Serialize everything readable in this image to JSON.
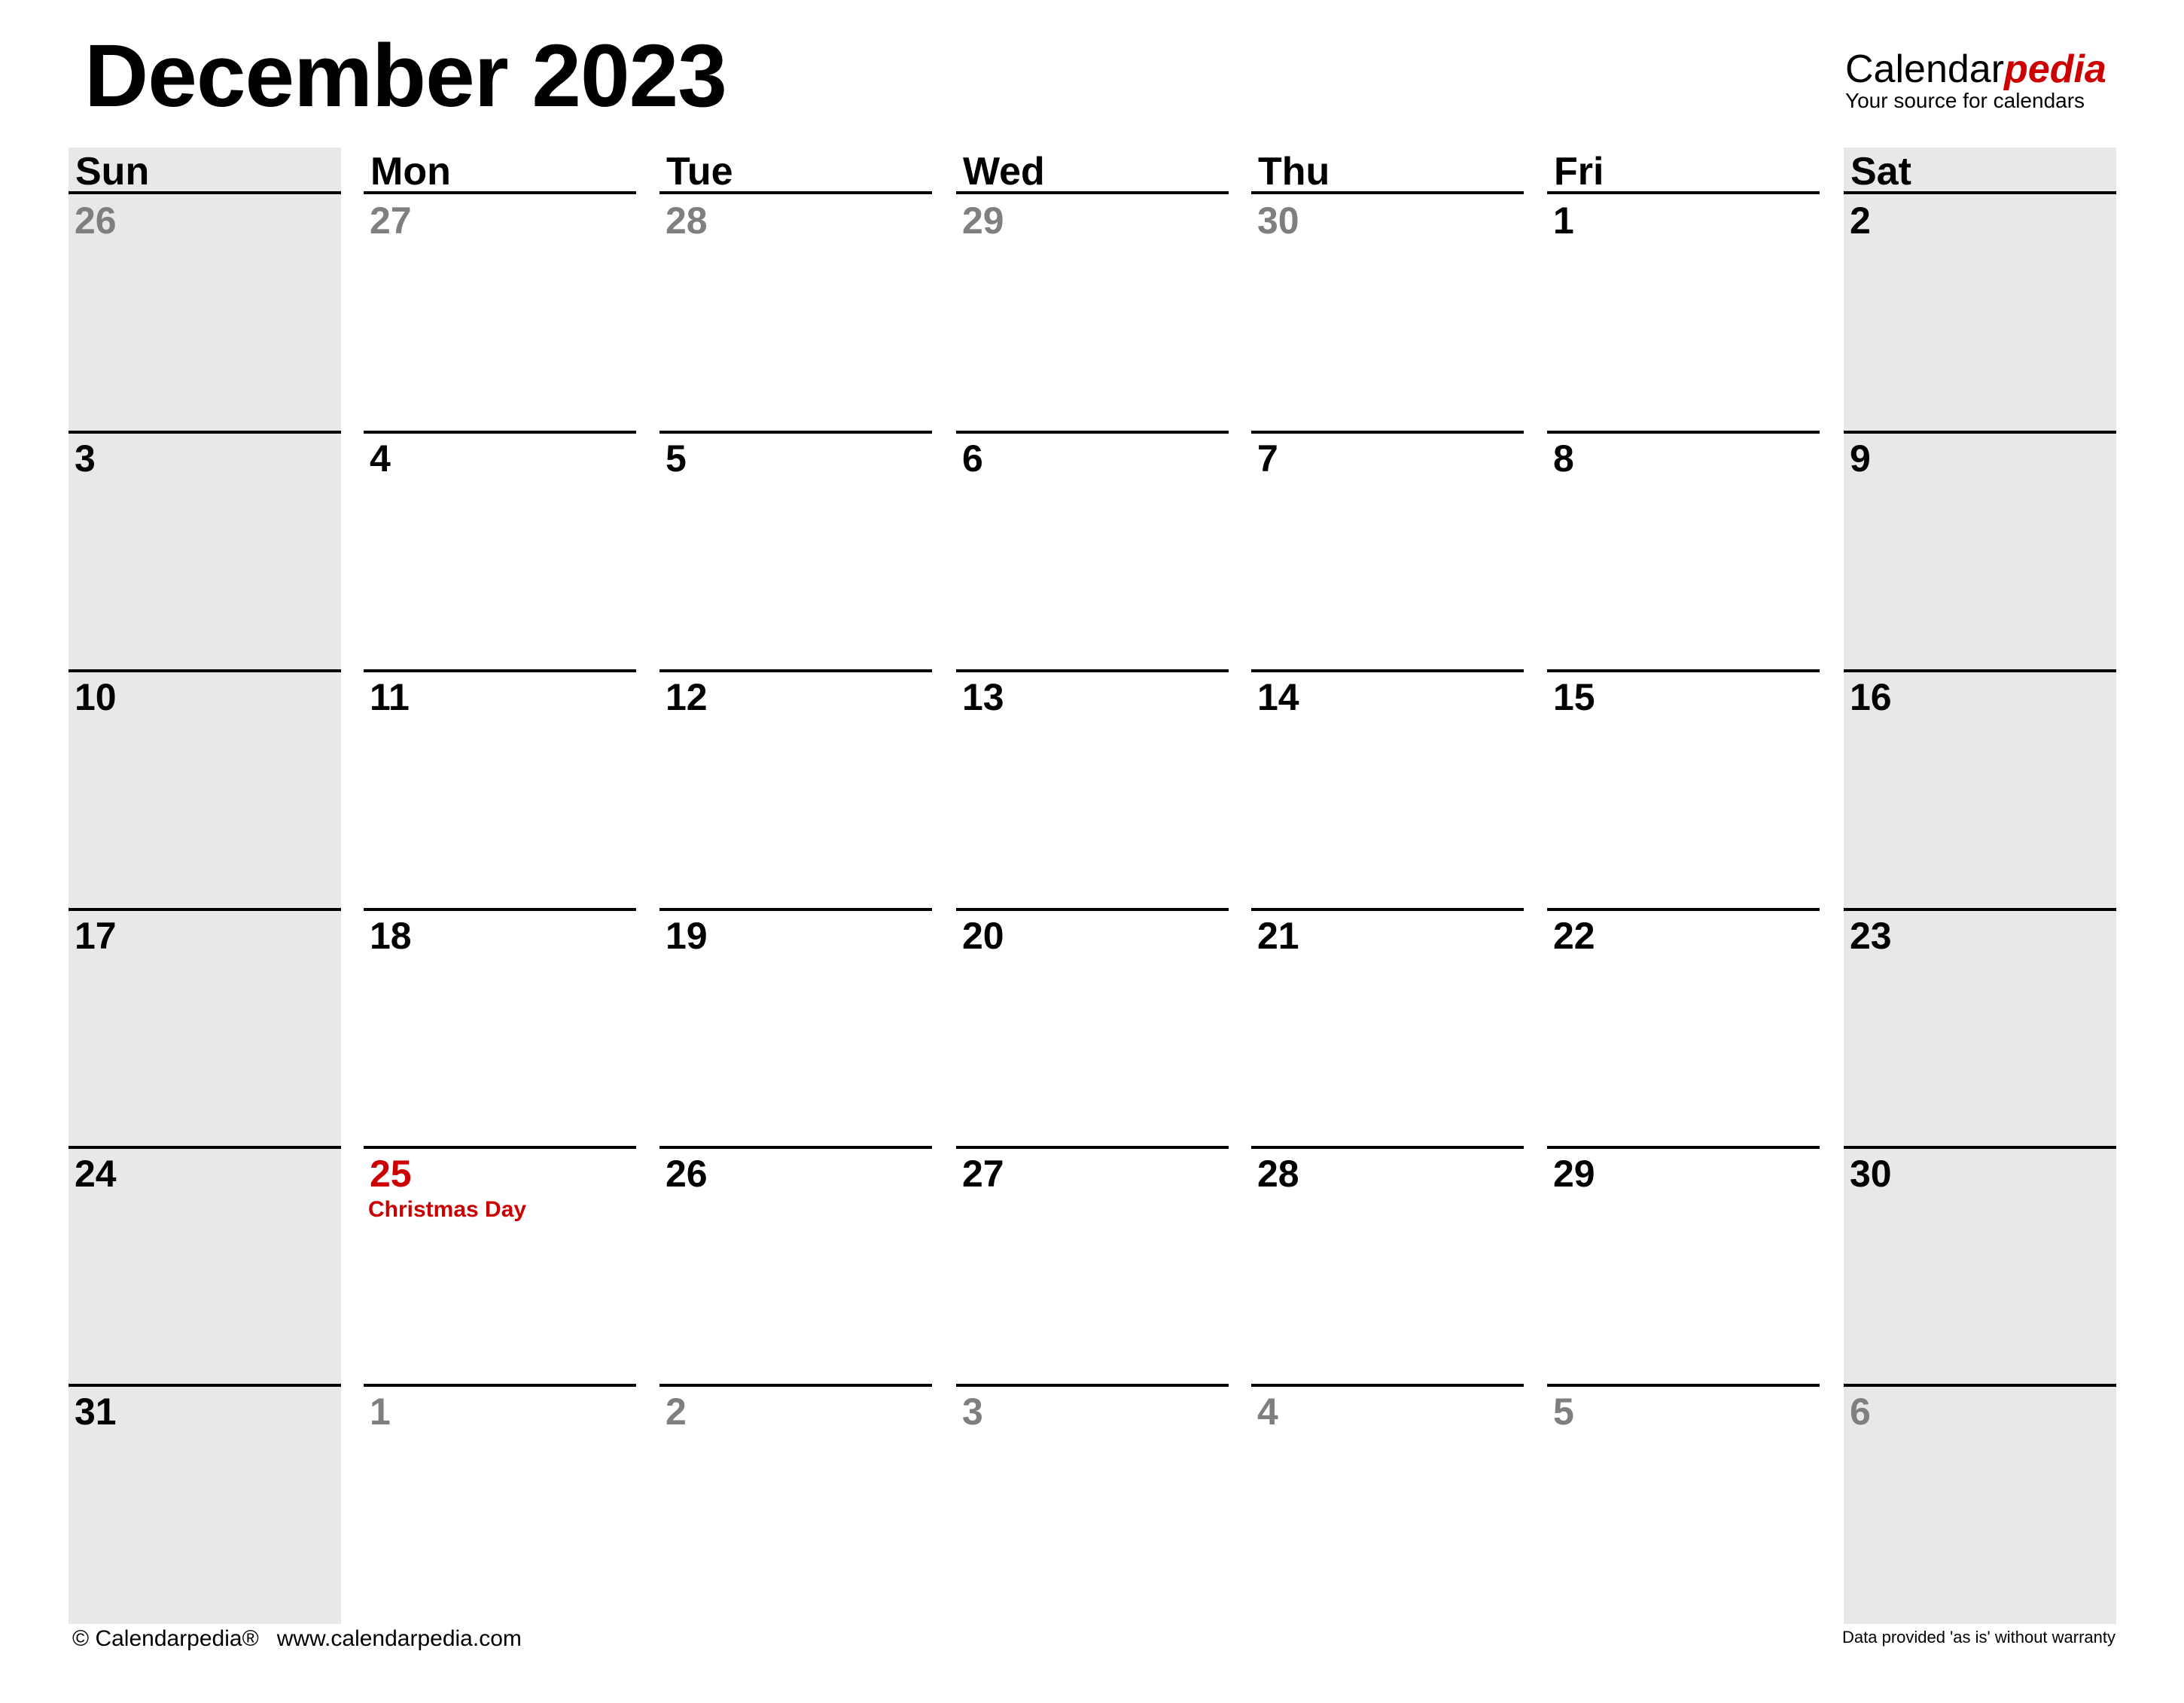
{
  "title": "December 2023",
  "logo": {
    "main": "Calendar",
    "accent": "pedia",
    "tagline": "Your source for calendars"
  },
  "colors": {
    "accent": "#cc0000",
    "weekend_bg": "#e8e8e8",
    "muted_text": "#7f7f7f"
  },
  "weekdays": [
    "Sun",
    "Mon",
    "Tue",
    "Wed",
    "Thu",
    "Fri",
    "Sat"
  ],
  "weeks": [
    [
      {
        "day": "26",
        "muted": true
      },
      {
        "day": "27",
        "muted": true
      },
      {
        "day": "28",
        "muted": true
      },
      {
        "day": "29",
        "muted": true
      },
      {
        "day": "30",
        "muted": true
      },
      {
        "day": "1"
      },
      {
        "day": "2"
      }
    ],
    [
      {
        "day": "3"
      },
      {
        "day": "4"
      },
      {
        "day": "5"
      },
      {
        "day": "6"
      },
      {
        "day": "7"
      },
      {
        "day": "8"
      },
      {
        "day": "9"
      }
    ],
    [
      {
        "day": "10"
      },
      {
        "day": "11"
      },
      {
        "day": "12"
      },
      {
        "day": "13"
      },
      {
        "day": "14"
      },
      {
        "day": "15"
      },
      {
        "day": "16"
      }
    ],
    [
      {
        "day": "17"
      },
      {
        "day": "18"
      },
      {
        "day": "19"
      },
      {
        "day": "20"
      },
      {
        "day": "21"
      },
      {
        "day": "22"
      },
      {
        "day": "23"
      }
    ],
    [
      {
        "day": "24"
      },
      {
        "day": "25",
        "holiday": "Christmas Day"
      },
      {
        "day": "26"
      },
      {
        "day": "27"
      },
      {
        "day": "28"
      },
      {
        "day": "29"
      },
      {
        "day": "30"
      }
    ],
    [
      {
        "day": "31"
      },
      {
        "day": "1",
        "muted": true
      },
      {
        "day": "2",
        "muted": true
      },
      {
        "day": "3",
        "muted": true
      },
      {
        "day": "4",
        "muted": true
      },
      {
        "day": "5",
        "muted": true
      },
      {
        "day": "6",
        "muted": true
      }
    ]
  ],
  "footer": {
    "copyright": "© Calendarpedia®",
    "url": "www.calendarpedia.com",
    "disclaimer": "Data provided 'as is' without warranty"
  }
}
